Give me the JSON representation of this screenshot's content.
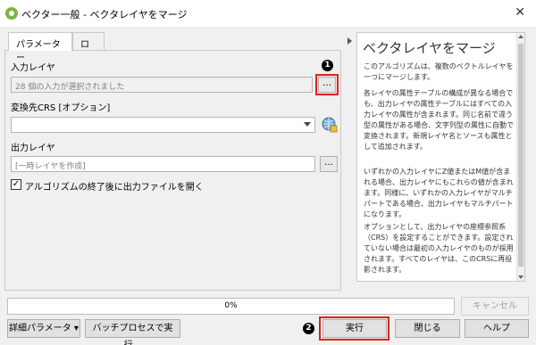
{
  "window": {
    "title": "ベクター一般 - ベクタレイヤをマージ",
    "close_glyph": "✕"
  },
  "tabs": [
    {
      "label": "パラメーター"
    },
    {
      "label": "ログ"
    }
  ],
  "params": {
    "input_label": "入力レイヤ",
    "input_value": "28 個の入力が選択されました",
    "input_browse": "…",
    "crs_label": "変換先CRS [オプション]",
    "crs_value": "",
    "output_label": "出力レイヤ",
    "output_placeholder": "[一時レイヤを作成]",
    "output_browse": "…",
    "open_after_label": "アルゴリズムの終了後に出力ファイルを開く",
    "open_after_checked": true,
    "checkmark": "✓"
  },
  "help": {
    "title": "ベクタレイヤをマージ",
    "paragraphs": [
      "このアルゴリズムは、複数のベクトルレイヤを一つにマージします。",
      "各レイヤの属性テーブルの構成が異なる場合でも、出力レイヤの属性テーブルにはすべての入力レイヤの属性が含まれます。同じ名前で違う型の属性がある場合、文字列型の属性に自動で変換されます。新規レイヤ名とソースも属性として追加されます。",
      "いずれかの入力レイヤにZ値またはM値が含まれる場合、出力レイヤにもこれらの値が含まれます。同様に、いずれかの入力レイヤがマルチパートである場合、出力レイヤもマルチパートになります。",
      "オプションとして、出力レイヤの座標参照系（CRS）を設定することができます。設定されていない場合は最初の入力レイヤのものが採用されます。すべてのレイヤは、このCRSに再投影されます。"
    ]
  },
  "progress": {
    "text": "0%",
    "value": 0
  },
  "buttons": {
    "cancel": "キャンセル",
    "advanced": "詳細パラメータ",
    "advanced_arrow": "▾",
    "batch": "バッチプロセスで実行...",
    "run": "実行",
    "close": "閉じる",
    "help": "ヘルプ"
  },
  "annotations": {
    "badge1": "1",
    "badge2": "2"
  }
}
